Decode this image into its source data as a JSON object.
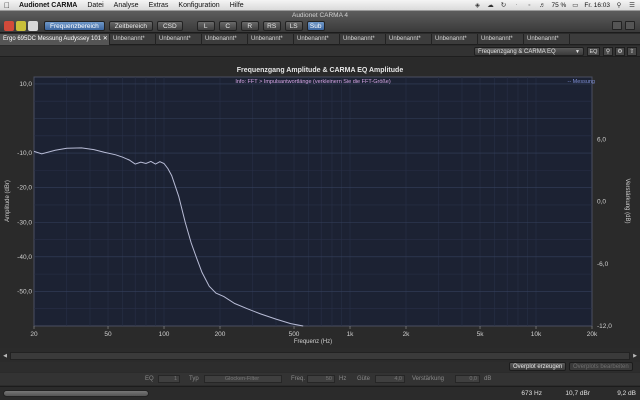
{
  "menubar": {
    "app": "Audionet CARMA",
    "items": [
      "Datei",
      "Analyse",
      "Extras",
      "Konfiguration",
      "Hilfe"
    ],
    "battery": "75 %",
    "clock": "Fr. 16:03"
  },
  "window": {
    "title": "Audionet CARMA 4"
  },
  "toolbar": {
    "buttons": [
      "Frequenzbereich",
      "Zeitbereich",
      "CSD"
    ],
    "channels": [
      "L",
      "C",
      "R",
      "RS",
      "LS",
      "Sub"
    ]
  },
  "tabs": [
    "Ergo 695DC Messung Audyssey 101 ✕",
    "Unbenannt*",
    "Unbenannt*",
    "Unbenannt*",
    "Unbenannt*",
    "Unbenannt*",
    "Unbenannt*",
    "Unbenannt*",
    "Unbenannt*",
    "Unbenannt*",
    "Unbenannt*",
    "Unbenannt*"
  ],
  "view_select": {
    "value": "Frequenzgang & CARMA EQ",
    "eq_label": "EQ"
  },
  "chart_data": {
    "type": "line",
    "title": "Frequenzgang Amplitude & CARMA EQ Amplitude",
    "info": "Info: FFT > Impulsantwortlänge (verkleinern Sie die FFT-Größe)",
    "legend": "-- Messung",
    "xlabel": "Frequenz (Hz)",
    "ylabel": "Amplitude (dBr)",
    "y2label": "Verstärkung (dB)",
    "xscale": "log",
    "xlim": [
      20,
      20000
    ],
    "ylim": [
      -60,
      12
    ],
    "y2lim": [
      -12,
      12
    ],
    "xticks": [
      20,
      50,
      100,
      200,
      500,
      1000,
      2000,
      5000,
      10000,
      20000
    ],
    "xtick_labels": [
      "20",
      "50",
      "100",
      "200",
      "500",
      "1k",
      "2k",
      "5k",
      "10k",
      "20k"
    ],
    "yticks": [
      10,
      -10,
      -20,
      -30,
      -40,
      -50
    ],
    "ytick_labels": [
      "10,0",
      "-10,0",
      "-20,0",
      "-30,0",
      "-40,0",
      "-50,0"
    ],
    "y2ticks": [
      6,
      0,
      -6,
      -12
    ],
    "y2tick_labels": [
      "6,0",
      "0,0",
      "-6,0",
      "-12,0"
    ],
    "series": [
      {
        "name": "Messung",
        "x": [
          20,
          22,
          26,
          30,
          36,
          42,
          48,
          55,
          60,
          65,
          70,
          75,
          80,
          85,
          90,
          95,
          100,
          105,
          110,
          120,
          130,
          140,
          150,
          160,
          175,
          190,
          210,
          240,
          280,
          330,
          400,
          480,
          560
        ],
        "y": [
          -9.5,
          -10.2,
          -9.2,
          -8.6,
          -8.5,
          -9.0,
          -9.8,
          -10.5,
          -11.2,
          -12.0,
          -13.2,
          -12.6,
          -13.0,
          -12.4,
          -13.2,
          -12.5,
          -13.0,
          -14.5,
          -16.5,
          -22.5,
          -30.0,
          -36.0,
          -40.5,
          -44.5,
          -48.5,
          -50.5,
          -51.5,
          -53.5,
          -55.0,
          -56.5,
          -58.0,
          -59.3,
          -60.0
        ]
      }
    ],
    "grid": true
  },
  "bottom": {
    "overplot_create": "Overplot erzeugen",
    "overplot_edit": "Overplots bearbeiten",
    "eq_label": "EQ",
    "eq_value": "1",
    "typ_label": "Typ",
    "typ_value": "Glocken-Filter",
    "freq_label": "Freq.",
    "freq_value": "50",
    "freq_unit": "Hz",
    "guete_label": "Güte",
    "guete_value": "4,0",
    "gain_label": "Verstärkung",
    "gain_value": "0,0",
    "gain_unit": "dB"
  },
  "status": {
    "freq": "673 Hz",
    "level": "10,7 dBr",
    "gain": "9,2 dB"
  },
  "colors": {
    "plot_bg": "#1c2233",
    "curve": "#b8bcd6",
    "accent": "#5b86bd",
    "legend": "#7f8fd6"
  }
}
